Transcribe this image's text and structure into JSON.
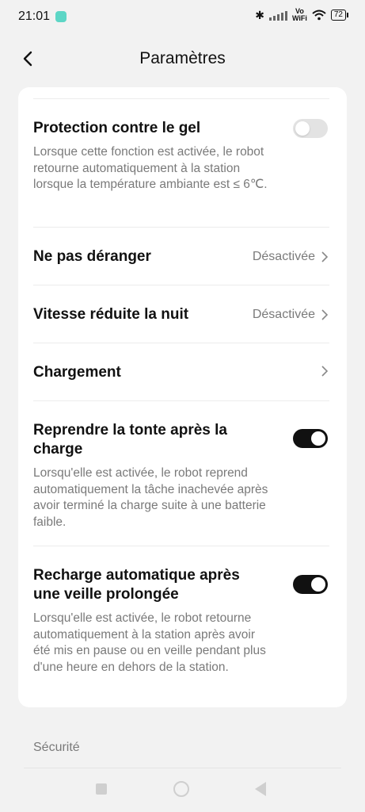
{
  "status_bar": {
    "time": "21:01",
    "network_label_line1": "Vo",
    "network_label_line2": "WiFi",
    "battery": "72"
  },
  "header": {
    "title": "Paramètres"
  },
  "settings": {
    "frost_protection": {
      "title": "Protection contre le gel",
      "description": "Lorsque cette fonction est activée, le robot retourne automatiquement à la station lorsque la température ambiante est ≤ 6℃.",
      "enabled": false
    },
    "do_not_disturb": {
      "title": "Ne pas déranger",
      "value": "Désactivée"
    },
    "night_slow_speed": {
      "title": "Vitesse réduite la nuit",
      "value": "Désactivée"
    },
    "charging": {
      "title": "Chargement"
    },
    "resume_after_charge": {
      "title": "Reprendre la tonte après la charge",
      "description": "Lorsqu'elle est activée, le robot reprend automatiquement la tâche inachevée après avoir terminé la charge suite à une batterie faible.",
      "enabled": true
    },
    "auto_recharge": {
      "title": "Recharge automatique après une veille prolongée",
      "description": "Lorsqu'elle est activée, le robot retourne automatiquement à la station après avoir été mis en pause ou en veille pendant plus d'une heure en dehors de la station.",
      "enabled": true
    }
  },
  "section": {
    "security_label": "Sécurité"
  },
  "colors": {
    "toggle_on": "#111111",
    "toggle_off": "#e3e3e3",
    "background": "#f2f2f2",
    "card": "#ffffff"
  }
}
